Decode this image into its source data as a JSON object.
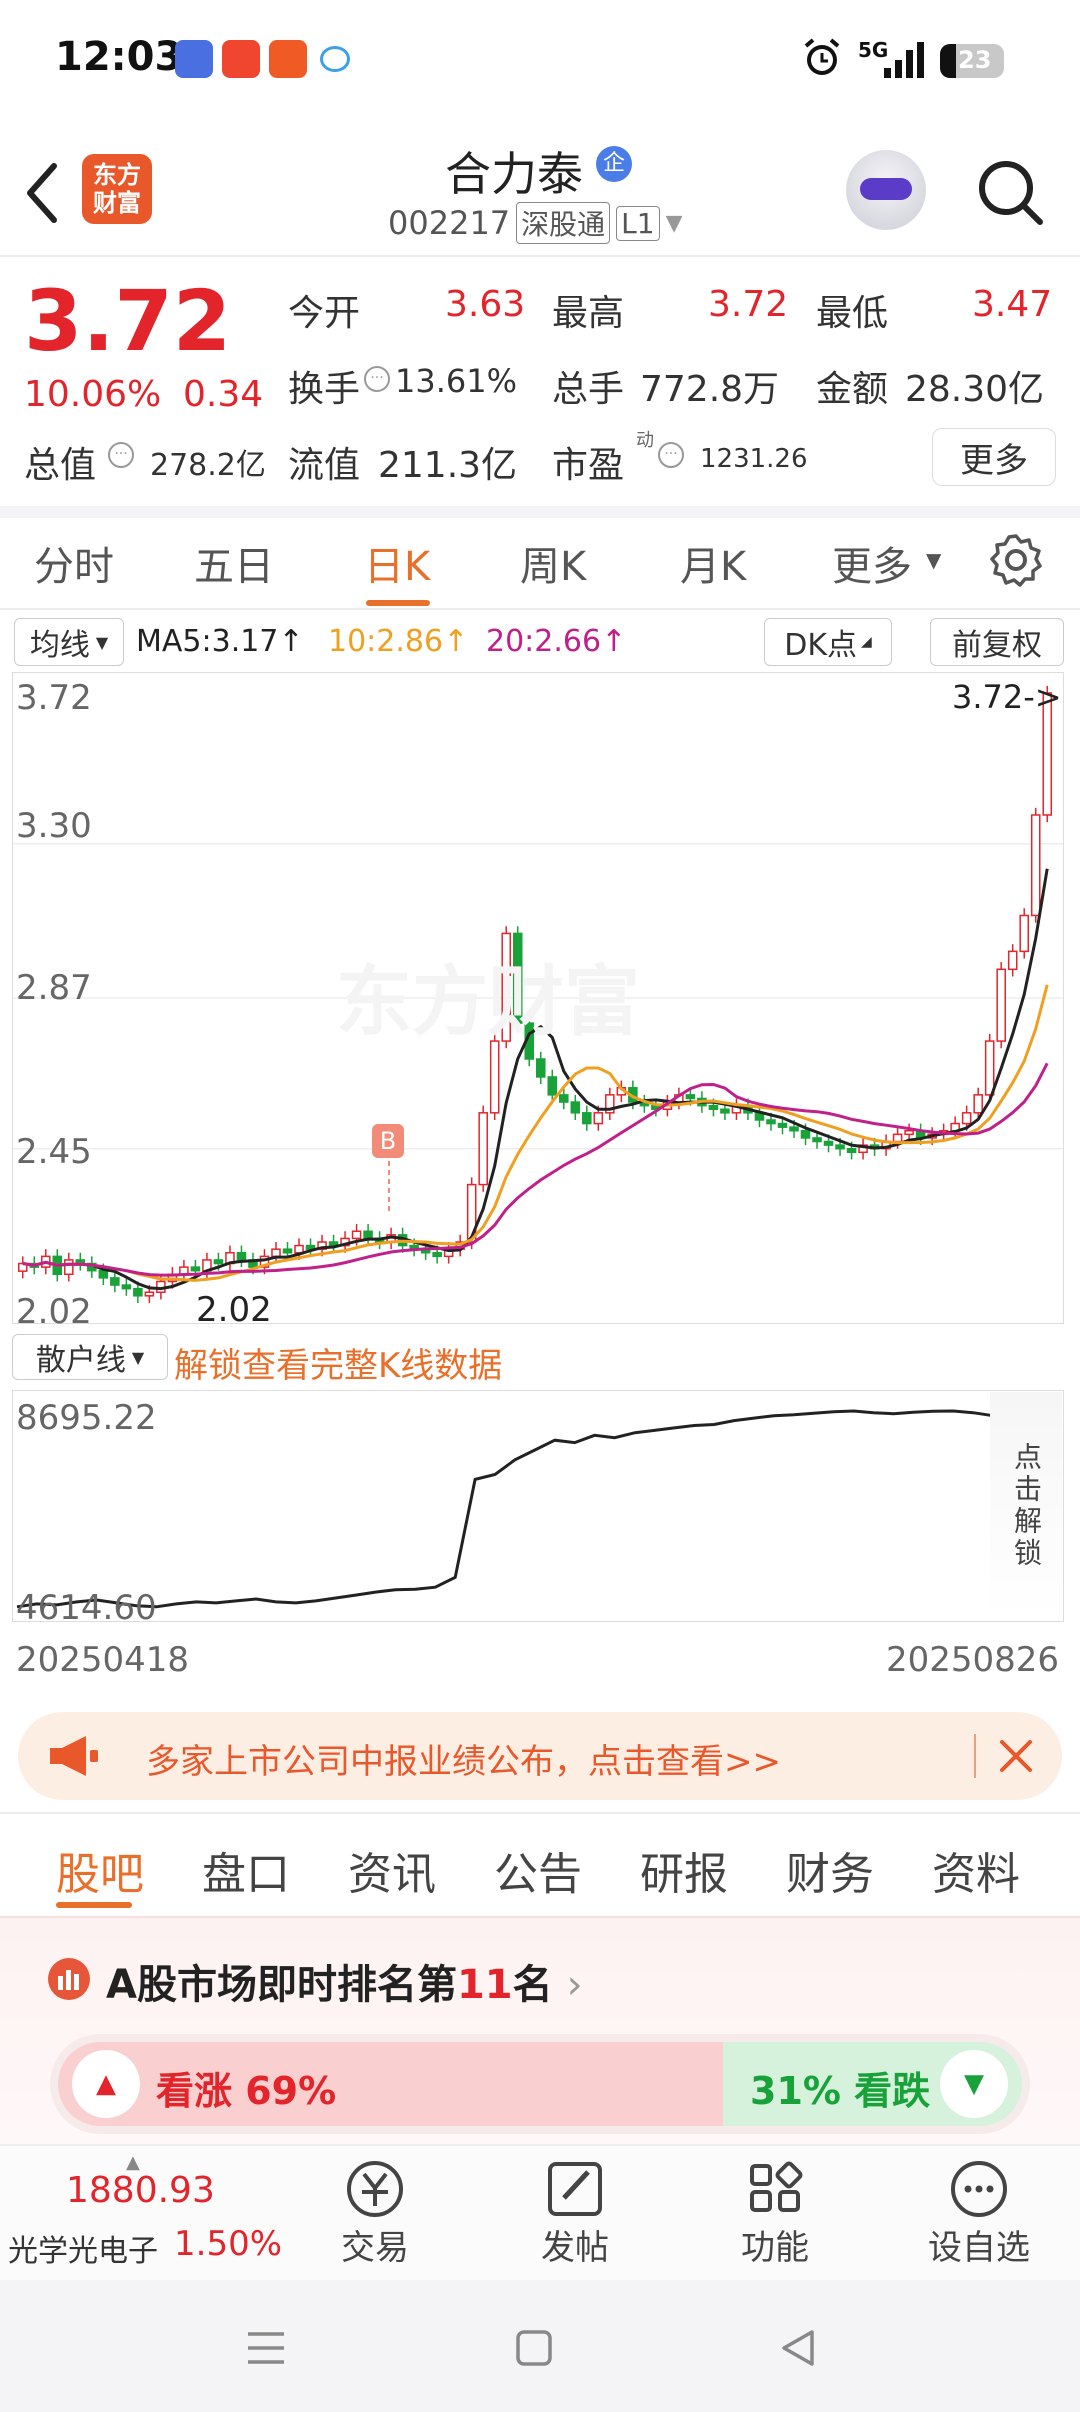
{
  "status": {
    "time": "12:03",
    "network": "5G",
    "battery": "23"
  },
  "header": {
    "logo_line1": "东方",
    "logo_line2": "财富",
    "stock_name": "合力泰",
    "badge": "企",
    "code": "002217",
    "tag1": "深股通",
    "tag2": "L1"
  },
  "quote": {
    "price": "3.72",
    "change_pct": "10.06%",
    "change_amt": "0.34",
    "open_label": "今开",
    "open": "3.63",
    "high_label": "最高",
    "high": "3.72",
    "low_label": "最低",
    "low": "3.47",
    "turnover_label": "换手",
    "turnover": "13.61%",
    "volume_label": "总手",
    "volume": "772.8万",
    "amount_label": "金额",
    "amount": "28.30亿",
    "mcap_label": "总值",
    "mcap": "278.2亿",
    "float_label": "流值",
    "float": "211.3亿",
    "pe_label": "市盈",
    "pe_sup": "动",
    "pe": "1231.26",
    "more": "更多"
  },
  "tabs": [
    "分时",
    "五日",
    "日K",
    "周K",
    "月K",
    "更多"
  ],
  "active_tab_index": 2,
  "ma_bar": {
    "selector": "均线",
    "ma5": "MA5:3.17↑",
    "ma10": "10:2.86↑",
    "ma20": "20:2.66↑",
    "dk": "DK点",
    "adjust": "前复权",
    "colors": {
      "ma5": "#222222",
      "ma10": "#f0a020",
      "ma20": "#c0208a"
    }
  },
  "chart_data": [
    {
      "type": "candlestick",
      "y_ticks": [
        "3.72",
        "3.30",
        "2.87",
        "2.45",
        "2.02"
      ],
      "ylim": [
        2.02,
        3.72
      ],
      "last_price_marker": "3.72->",
      "low_marker": "2.02",
      "buy_marker": "B",
      "watermark": "东方财富",
      "x_start": "20250418",
      "x_end": "20250826",
      "closes": [
        2.13,
        2.12,
        2.15,
        2.1,
        2.14,
        2.13,
        2.11,
        2.09,
        2.07,
        2.06,
        2.04,
        2.05,
        2.08,
        2.1,
        2.12,
        2.11,
        2.14,
        2.13,
        2.16,
        2.14,
        2.12,
        2.15,
        2.17,
        2.16,
        2.18,
        2.17,
        2.19,
        2.18,
        2.2,
        2.22,
        2.2,
        2.19,
        2.21,
        2.18,
        2.17,
        2.16,
        2.15,
        2.17,
        2.19,
        2.35,
        2.55,
        2.75,
        3.05,
        2.8,
        2.7,
        2.65,
        2.6,
        2.58,
        2.55,
        2.52,
        2.55,
        2.6,
        2.62,
        2.58,
        2.57,
        2.56,
        2.58,
        2.6,
        2.59,
        2.57,
        2.56,
        2.55,
        2.57,
        2.55,
        2.53,
        2.52,
        2.51,
        2.5,
        2.48,
        2.47,
        2.46,
        2.45,
        2.44,
        2.46,
        2.45,
        2.47,
        2.49,
        2.5,
        2.48,
        2.49,
        2.5,
        2.52,
        2.55,
        2.6,
        2.75,
        2.95,
        3.0,
        3.1,
        3.38,
        3.72
      ]
    },
    {
      "type": "line",
      "name": "散户线",
      "y_ticks": [
        "8695.22",
        "4614.60"
      ],
      "ylim": [
        4614.6,
        8695.22
      ],
      "values": [
        4700,
        4760,
        4740,
        4800,
        4840,
        4780,
        4720,
        4700,
        4760,
        4800,
        4780,
        4820,
        4860,
        4800,
        4780,
        4820,
        4880,
        4940,
        5000,
        5050,
        5060,
        5100,
        5300,
        7300,
        7400,
        7700,
        7900,
        8100,
        8050,
        8200,
        8150,
        8250,
        8300,
        8350,
        8400,
        8420,
        8500,
        8550,
        8600,
        8620,
        8650,
        8680,
        8695,
        8660,
        8640,
        8670,
        8690,
        8695,
        8660,
        8600
      ]
    }
  ],
  "sub_indicator": {
    "selector": "散户线",
    "unlock_text": "解锁查看完整K线数据",
    "side_unlock": "点击解锁"
  },
  "banner": {
    "text": "多家上市公司中报业绩公布，点击查看>>"
  },
  "lower_tabs": [
    "股吧",
    "盘口",
    "资讯",
    "公告",
    "研报",
    "财务",
    "资料"
  ],
  "lower_active_index": 0,
  "rank": {
    "prefix": "A股市场即时排名第",
    "number": "11",
    "suffix": "名"
  },
  "sentiment": {
    "up_label": "看涨 69%",
    "down_label": "31% 看跌",
    "up_pct": 69
  },
  "bottom_bar": {
    "index_value": "1880.93",
    "index_name": "光学光电子",
    "index_change": "1.50%",
    "trade": "交易",
    "post": "发帖",
    "function": "功能",
    "watchlist": "设自选"
  }
}
